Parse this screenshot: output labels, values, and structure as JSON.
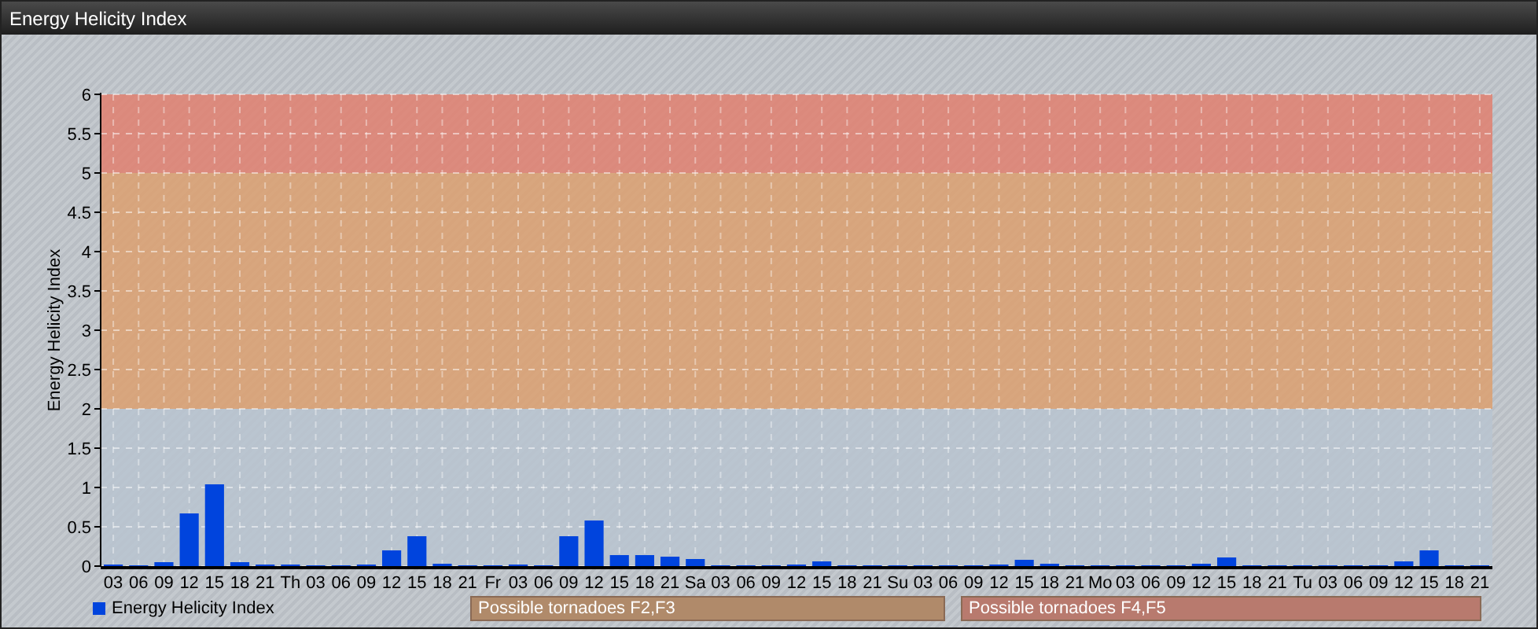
{
  "window": {
    "title": "Energy Helicity Index"
  },
  "chart": {
    "chart_data": {
      "type": "bar",
      "ylabel": "Energy Helicity Index",
      "categories": [
        "03",
        "06",
        "09",
        "12",
        "15",
        "18",
        "21",
        "Th",
        "03",
        "06",
        "09",
        "12",
        "15",
        "18",
        "21",
        "Fr",
        "03",
        "06",
        "09",
        "12",
        "15",
        "18",
        "21",
        "Sa",
        "03",
        "06",
        "09",
        "12",
        "15",
        "18",
        "21",
        "Su",
        "03",
        "06",
        "09",
        "12",
        "15",
        "18",
        "21",
        "Mo",
        "03",
        "06",
        "09",
        "12",
        "15",
        "18",
        "21",
        "Tu",
        "03",
        "06",
        "09",
        "12",
        "15",
        "18",
        "21"
      ],
      "series": [
        {
          "name": "Energy Helicity Index",
          "color": "#0044dd",
          "values": [
            0.02,
            0.01,
            0.05,
            0.67,
            1.04,
            0.05,
            0.02,
            0.02,
            0.01,
            0.01,
            0.02,
            0.2,
            0.38,
            0.03,
            0.01,
            0.01,
            0.02,
            0.01,
            0.38,
            0.58,
            0.14,
            0.14,
            0.12,
            0.09,
            0.01,
            0.01,
            0.01,
            0.02,
            0.06,
            0.01,
            0.01,
            0.01,
            0.01,
            0.01,
            0.01,
            0.02,
            0.08,
            0.03,
            0.01,
            0.01,
            0.01,
            0.01,
            0.01,
            0.03,
            0.11,
            0.01,
            0.01,
            0.01,
            0.01,
            0.01,
            0.01,
            0.06,
            0.2,
            0.01,
            0.01
          ]
        }
      ],
      "ylim": [
        0,
        6
      ],
      "yticks": [
        0,
        {
          "value": 0.5,
          "label": "0.5"
        },
        1,
        {
          "value": 1.5,
          "label": "1.5"
        },
        2,
        {
          "value": 2.5,
          "label": "2.5"
        },
        3,
        {
          "value": 3.5,
          "label": "3.5"
        },
        4,
        {
          "value": 4.5,
          "label": "4.5"
        },
        5,
        {
          "value": 5.5,
          "label": "5.5"
        },
        6
      ],
      "grid": true,
      "bands": [
        {
          "axis": "y",
          "from": 0,
          "to": 2,
          "color": "#b8c4d0"
        },
        {
          "axis": "y",
          "from": 2,
          "to": 5,
          "color": "#dca070"
        },
        {
          "axis": "y",
          "from": 5,
          "to": 6,
          "color": "#e08070"
        }
      ]
    }
  },
  "zones": [
    {
      "label": "Possible tornadoes F2,F3",
      "color": "#b08a6a"
    },
    {
      "label": "Possible tornadoes F4,F5",
      "color": "#b87a6e"
    }
  ]
}
